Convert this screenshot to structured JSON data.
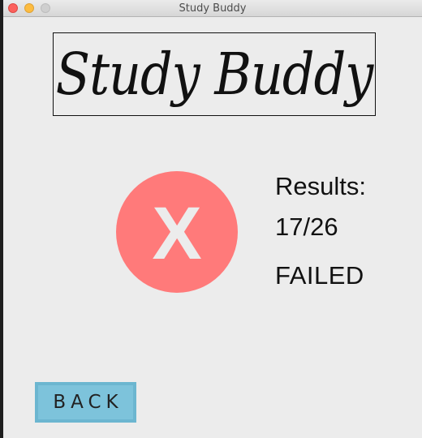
{
  "window": {
    "title": "Study Buddy"
  },
  "logo": {
    "text": "Study Buddy"
  },
  "result": {
    "icon": "x-icon",
    "icon_glyph": "X",
    "circle_color": "#ff7a7a",
    "results_label": "Results:",
    "score": "17/26",
    "status": "FAILED"
  },
  "actions": {
    "back_label": "BACK",
    "back_color": "#7dc3db"
  }
}
